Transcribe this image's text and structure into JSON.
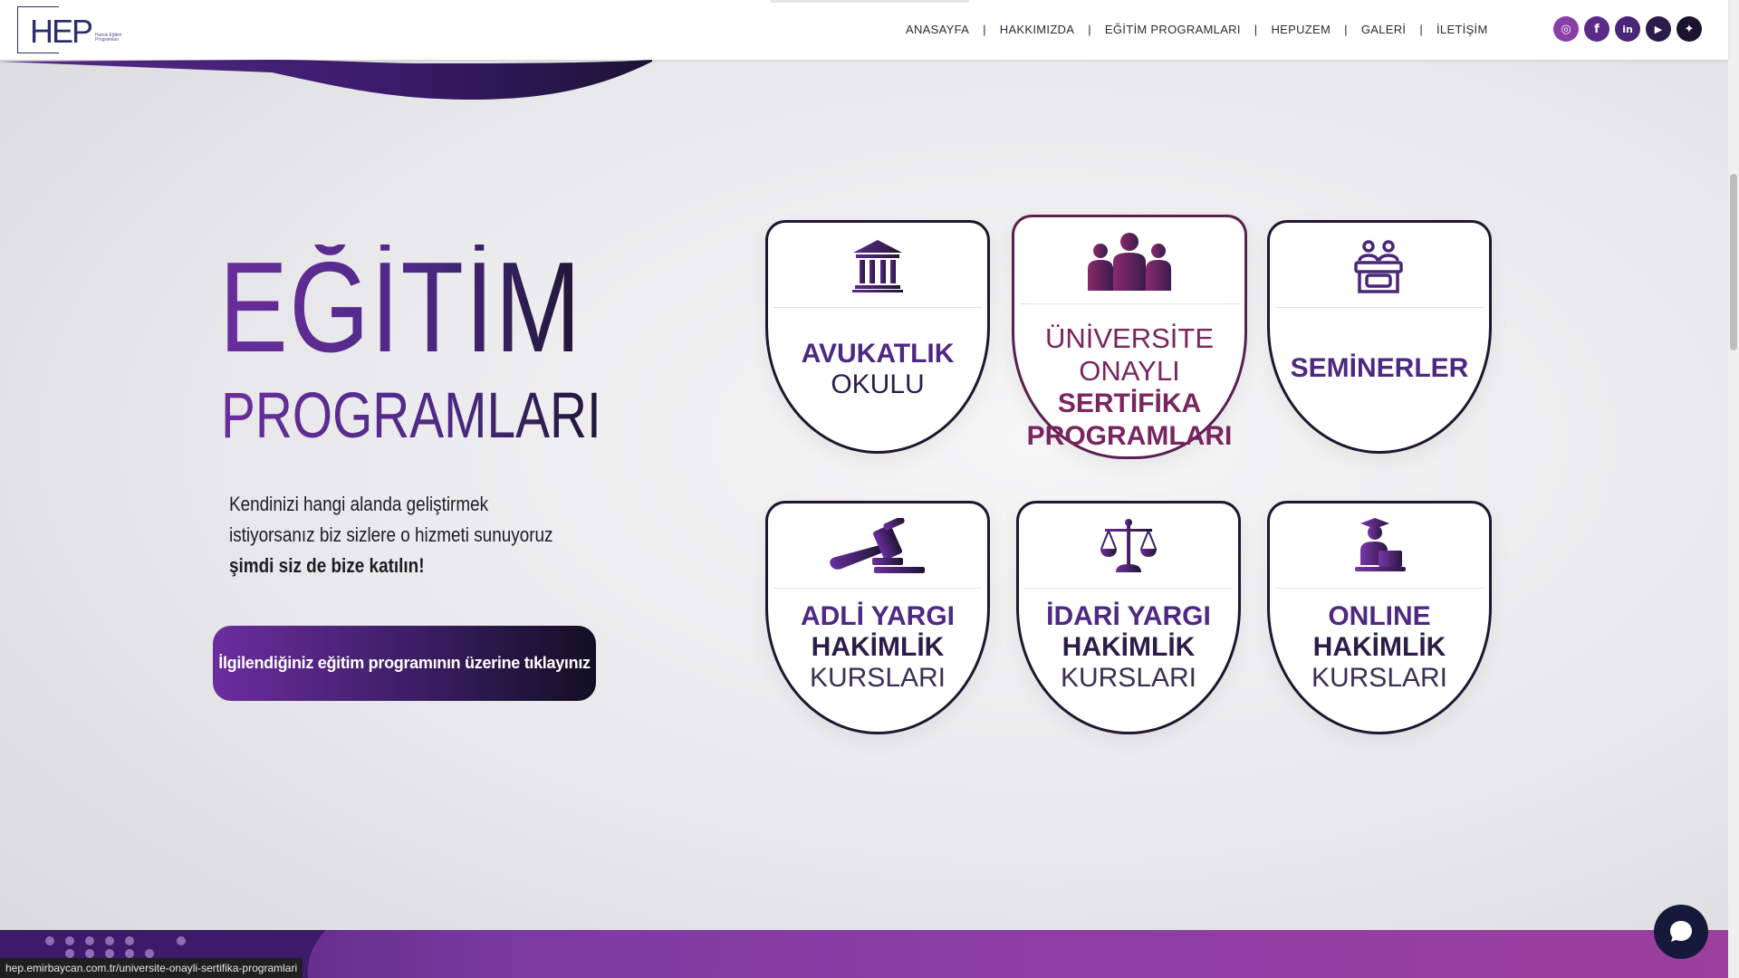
{
  "header": {
    "logo_text": "HEP",
    "logo_sub": "Hukuk Eğitim Programları",
    "nav": [
      "ANASAYFA",
      "HAKKIMIZDA",
      "EĞİTİM PROGRAMLARI",
      "HEPUZEM",
      "GALERİ",
      "İLETİŞİM"
    ],
    "separator": "|",
    "social": [
      {
        "name": "instagram-icon",
        "glyph": "◎",
        "color": "#8a3fa8"
      },
      {
        "name": "facebook-icon",
        "glyph": "f",
        "color": "#5b2b8a"
      },
      {
        "name": "linkedin-icon",
        "glyph": "in",
        "color": "#4a2678"
      },
      {
        "name": "youtube-icon",
        "glyph": "▶",
        "color": "#2c1c4a"
      },
      {
        "name": "twitter-icon",
        "glyph": "✦",
        "color": "#1a1430"
      }
    ]
  },
  "hero": {
    "title": "EĞİTİM",
    "subtitle": "PROGRAMLARI",
    "text_line1": "Kendinizi hangi alanda geliştirmek",
    "text_line2": "istiyorsanız biz sizlere o hizmeti sunuyoruz",
    "text_bold": "şimdi siz de bize katılın!",
    "cta": "İlgilendiğiniz eğitim programının üzerine tıklayınız"
  },
  "cards": [
    {
      "icon": "courthouse-icon",
      "line1": "AVUKATLIK",
      "line2": "OKULU",
      "line3": ""
    },
    {
      "icon": "group-people-icon",
      "line1": "ÜNİVERSİTE ONAYLI",
      "line2": "SERTİFİKA",
      "line3": "PROGRAMLARI"
    },
    {
      "icon": "seminar-icon",
      "line1": "SEMİNERLER",
      "line2": "",
      "line3": ""
    },
    {
      "icon": "gavel-icon",
      "line1": "ADLİ YARGI",
      "line2": "HAKİMLİK",
      "line3": "KURSLARI"
    },
    {
      "icon": "scales-icon",
      "line1": "İDARİ YARGI",
      "line2": "HAKİMLİK",
      "line3": "KURSLARI"
    },
    {
      "icon": "online-student-icon",
      "line1": "ONLINE",
      "line2": "HAKİMLİK",
      "line3": "KURSLARI"
    }
  ],
  "status_url": "hep.emirbaycan.com.tr/universite-onayli-sertifika-programlari",
  "colors": {
    "primary_purple": "#4e2883",
    "accent_magenta": "#7a2460",
    "dark": "#1f1630"
  }
}
